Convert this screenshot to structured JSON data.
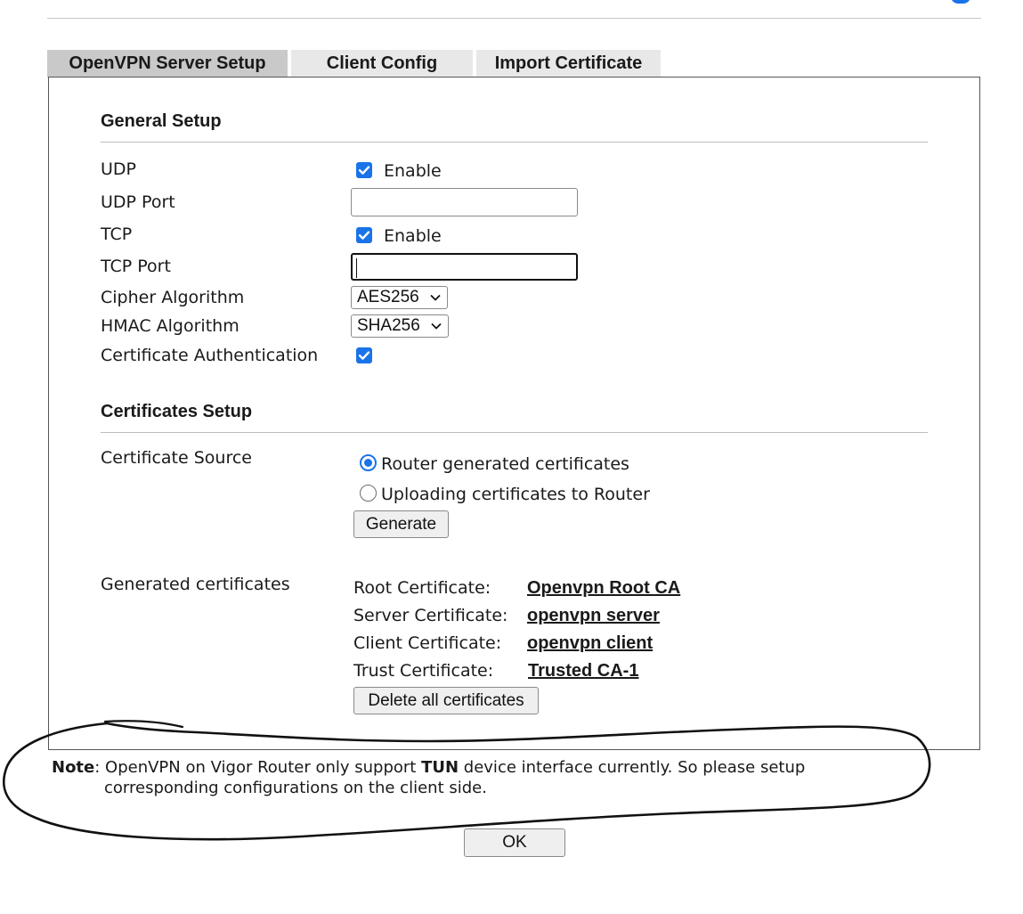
{
  "tabs": [
    {
      "label": "OpenVPN Server Setup",
      "active": true
    },
    {
      "label": "Client Config",
      "active": false
    },
    {
      "label": "Import Certificate",
      "active": false
    }
  ],
  "general": {
    "title": "General Setup",
    "udp_label": "UDP",
    "udp_enable": "Enable",
    "udp_port_label": "UDP Port",
    "udp_port_value": "",
    "tcp_label": "TCP",
    "tcp_enable": "Enable",
    "tcp_port_label": "TCP Port",
    "tcp_port_value": "",
    "cipher_label": "Cipher Algorithm",
    "cipher_value": "AES256",
    "hmac_label": "HMAC Algorithm",
    "hmac_value": "SHA256",
    "cert_auth_label": "Certificate Authentication"
  },
  "certs": {
    "title": "Certificates Setup",
    "source_label": "Certificate Source",
    "option_router": "Router generated certificates",
    "option_upload": "Uploading certificates to Router",
    "generate_label": "Generate",
    "generated_label": "Generated certificates",
    "items": [
      {
        "label": "Root Certificate:",
        "link": "Openvpn Root CA"
      },
      {
        "label": "Server Certificate:",
        "link": "openvpn server"
      },
      {
        "label": "Client Certificate:",
        "link": "openvpn client"
      },
      {
        "label": "Trust Certificate:",
        "link": "Trusted CA-1"
      }
    ],
    "delete_label": "Delete all certificates"
  },
  "note": {
    "lead": "Note",
    "text_before": ": OpenVPN on Vigor Router only support ",
    "bold": "TUN",
    "text_after": " device interface currently. So please setup",
    "line2": "corresponding configurations on the client side."
  },
  "ok_label": "OK",
  "colors": {
    "accent": "#1a73e8",
    "tab_active": "#c9c9c9",
    "tab_inactive": "#e8e8e8"
  }
}
